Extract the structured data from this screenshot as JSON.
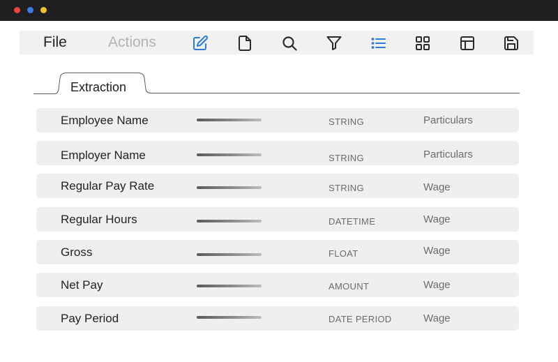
{
  "window": {
    "controls": [
      "close",
      "minimize",
      "maximize"
    ]
  },
  "menu": {
    "file_label": "File",
    "actions_label": "Actions"
  },
  "toolbar": {
    "icons": [
      "edit-icon",
      "document-icon",
      "search-icon",
      "filter-icon",
      "list-icon",
      "grid-icon",
      "layout-icon",
      "save-icon"
    ],
    "active_color": "#2f7bd8",
    "icon_color": "#2a2a2a"
  },
  "tabs": [
    {
      "label": "Extraction",
      "active": true
    }
  ],
  "fields": [
    {
      "name": "Employee Name",
      "type": "STRING",
      "category": "Particulars"
    },
    {
      "name": "Employer Name",
      "type": "STRING",
      "category": "Particulars"
    },
    {
      "name": "Regular Pay Rate",
      "type": "STRING",
      "category": "Wage"
    },
    {
      "name": "Regular Hours",
      "type": "DATETIME",
      "category": "Wage"
    },
    {
      "name": "Gross",
      "type": "FLOAT",
      "category": "Wage"
    },
    {
      "name": "Net Pay",
      "type": "AMOUNT",
      "category": "Wage"
    },
    {
      "name": "Pay Period",
      "type": "DATE PERIOD",
      "category": "Wage"
    }
  ]
}
